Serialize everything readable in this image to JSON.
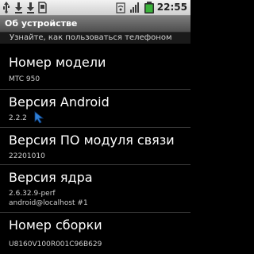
{
  "status_bar": {
    "time": "22:55",
    "icons": [
      "usb-icon",
      "download-icon",
      "download-icon",
      "sdcard-icon",
      "wifi-icon",
      "signal-icon",
      "battery-icon"
    ]
  },
  "title_bar": {
    "title": "Об устройстве"
  },
  "subheader": {
    "text": "Узнайте, как пользоваться телефоном"
  },
  "items": [
    {
      "title": "Номер модели",
      "values": [
        "MTC 950"
      ]
    },
    {
      "title": "Версия Android",
      "values": [
        "2.2.2"
      ]
    },
    {
      "title": "Версия ПО модуля связи",
      "values": [
        "22201010"
      ]
    },
    {
      "title": "Версия ядра",
      "values": [
        "2.6.32.9-perf",
        "android@localhost #1"
      ]
    },
    {
      "title": "Номер сборки",
      "values": [
        "U8160V100R001C96B629"
      ]
    }
  ],
  "colors": {
    "statusbar": "#dcdcdc",
    "titlebar": "#666666",
    "background": "#000000",
    "battery": "#3bb33b"
  }
}
